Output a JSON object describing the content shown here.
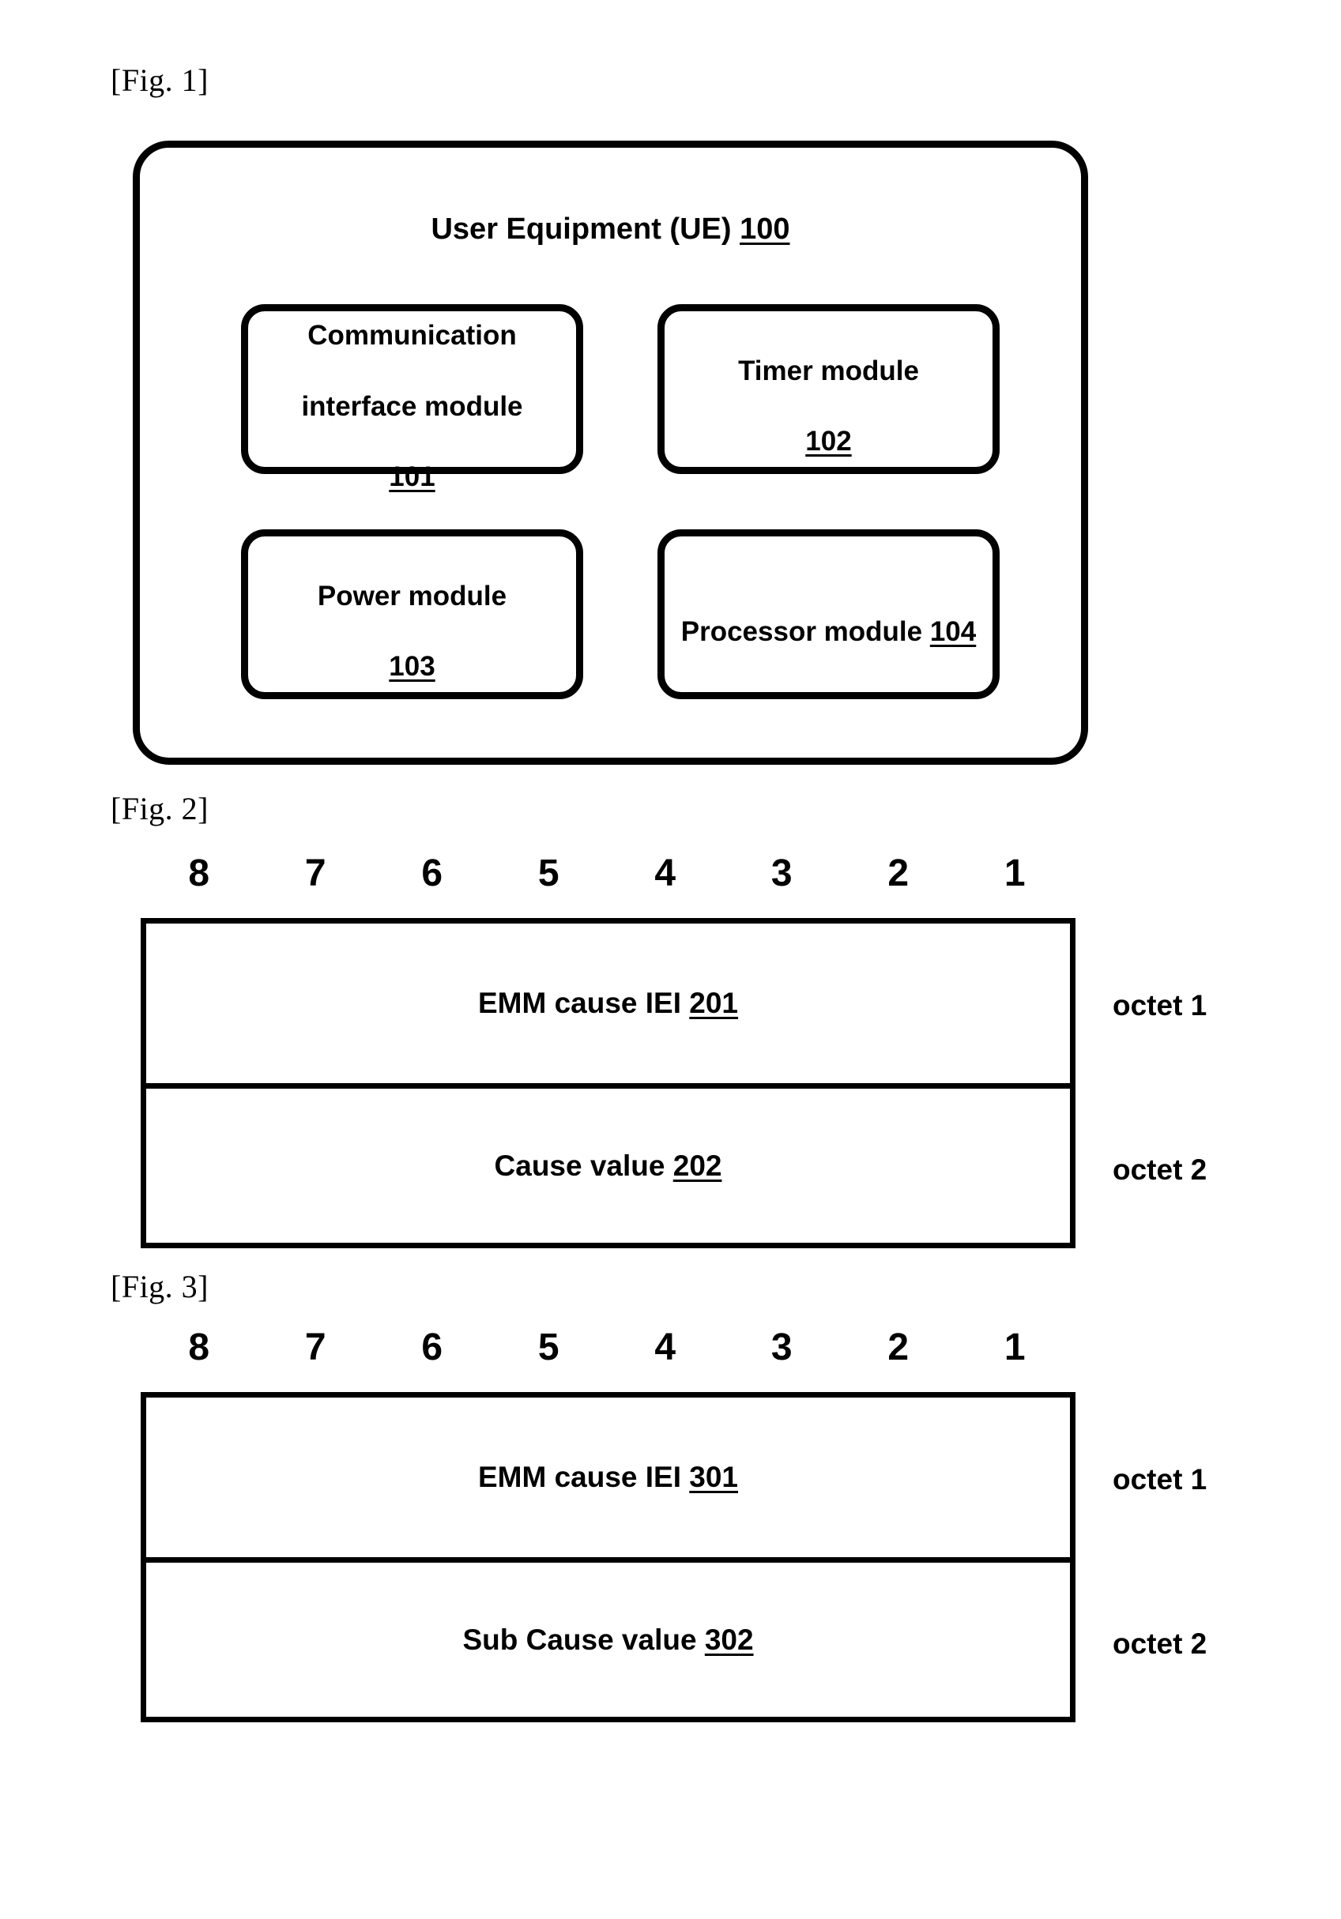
{
  "figures": [
    {
      "caption": "[Fig. 1]",
      "ue": {
        "title_text": "User Equipment (UE) ",
        "title_ref": "100 ",
        "modules": [
          {
            "name_line1": "Communication",
            "name_line2": "interface module",
            "ref": "101",
            "inline": false
          },
          {
            "name_line1": "Timer module",
            "name_line2": "",
            "ref": "102",
            "inline": false
          },
          {
            "name_line1": "Power module",
            "name_line2": "",
            "ref": "103",
            "inline": false
          },
          {
            "name_line1": "Processor module ",
            "name_line2": "",
            "ref": "104",
            "inline": true
          }
        ]
      }
    },
    {
      "caption": "[Fig. 2]",
      "bits": [
        "8",
        "7",
        "6",
        "5",
        "4",
        "3",
        "2",
        "1"
      ],
      "rows": [
        {
          "text": "EMM cause IEI ",
          "ref": "201",
          "octet": "octet 1"
        },
        {
          "text": "Cause value ",
          "ref": "202",
          "octet": "octet 2"
        }
      ]
    },
    {
      "caption": "[Fig. 3]",
      "bits": [
        "8",
        "7",
        "6",
        "5",
        "4",
        "3",
        "2",
        "1"
      ],
      "rows": [
        {
          "text": "EMM cause IEI ",
          "ref": "301",
          "octet": "octet 1"
        },
        {
          "text": "Sub Cause value ",
          "ref": "302",
          "octet": "octet 2"
        }
      ]
    }
  ],
  "colors": {
    "ink": "#000000",
    "paper": "#ffffff"
  }
}
